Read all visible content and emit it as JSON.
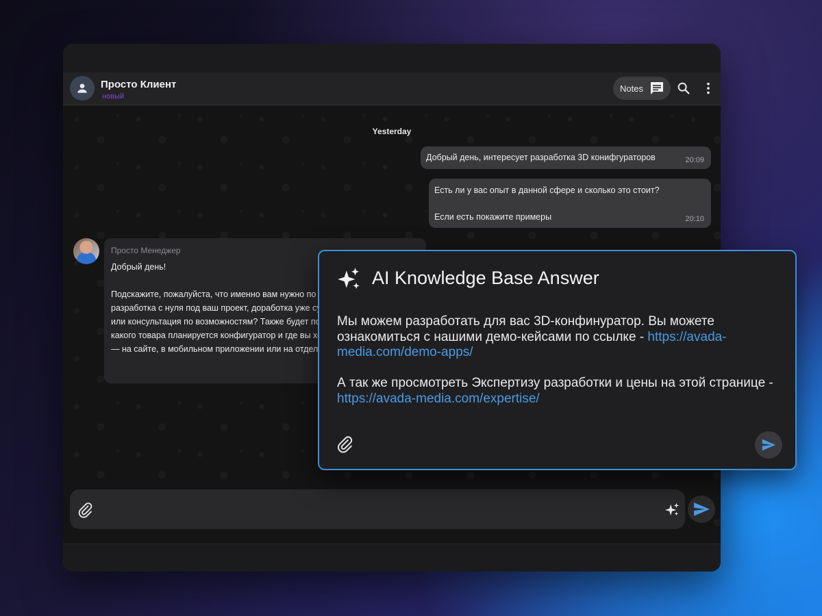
{
  "header": {
    "contact_name": "Просто Клиент",
    "contact_status": "новый",
    "notes_label": "Notes"
  },
  "chat": {
    "day_label": "Yesterday",
    "outgoing": [
      {
        "text": "Добрый день,  интересует разработка 3D конифгураторов",
        "time": "20:09"
      },
      {
        "line1": "Есть ли у вас опыт в данной сфере и сколько это стоит?",
        "line2": "Если есть покажите примеры",
        "time": "20:10"
      }
    ],
    "incoming": {
      "sender": "Просто Менеджер",
      "greeting": "Добрый день!",
      "body": "Подскажите, пожалуйста, что именно вам нужно по 3D-конфигураторам: разработка с нуля под ваш проект, доработка уже существующего решения или консультация по возможностям? Также будет полезно понять, для какого товара планируется конфигуратор и где вы хотите его использовать — на сайте, в мобильном приложении или на отдельной платформе."
    }
  },
  "ai_card": {
    "title": "AI Knowledge Base Answer",
    "para1_text": "Мы можем разработать для вас 3D-конфинуратор. Вы можете ознакомиться с нашими демо-кейсами по ссылке - ",
    "para1_link": "https://avada-media.com/demo-apps/",
    "para2_text": "А так же просмотреть Экспертизу разработки и цены на этой странице - ",
    "para2_link": "https://avada-media.com/expertise/"
  },
  "colors": {
    "accent_blue": "#3c8fd8",
    "link_blue": "#4a9be6",
    "status_purple": "#7d4bd0"
  },
  "icons": [
    "person-icon",
    "notes-icon",
    "search-icon",
    "more-vertical-icon",
    "paperclip-icon",
    "sparkle-icon",
    "send-icon"
  ]
}
